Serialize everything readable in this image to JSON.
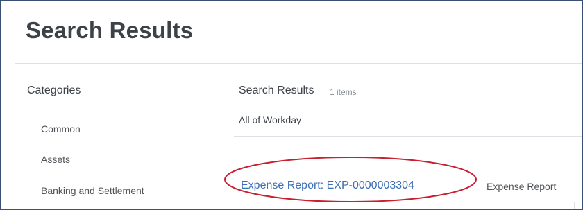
{
  "page": {
    "title": "Search Results"
  },
  "categories": {
    "heading": "Categories",
    "items": [
      {
        "label": "Common"
      },
      {
        "label": "Assets"
      },
      {
        "label": "Banking and Settlement"
      }
    ]
  },
  "results": {
    "header": "Search Results",
    "count": "1 items",
    "scope": "All of Workday",
    "items": [
      {
        "title": "Expense Report: EXP-0000003304",
        "type": "Expense Report"
      }
    ]
  },
  "colors": {
    "border": "#3a4f73",
    "link": "#3c6fb4",
    "highlight": "#c8202f",
    "text": "#3d4248"
  }
}
